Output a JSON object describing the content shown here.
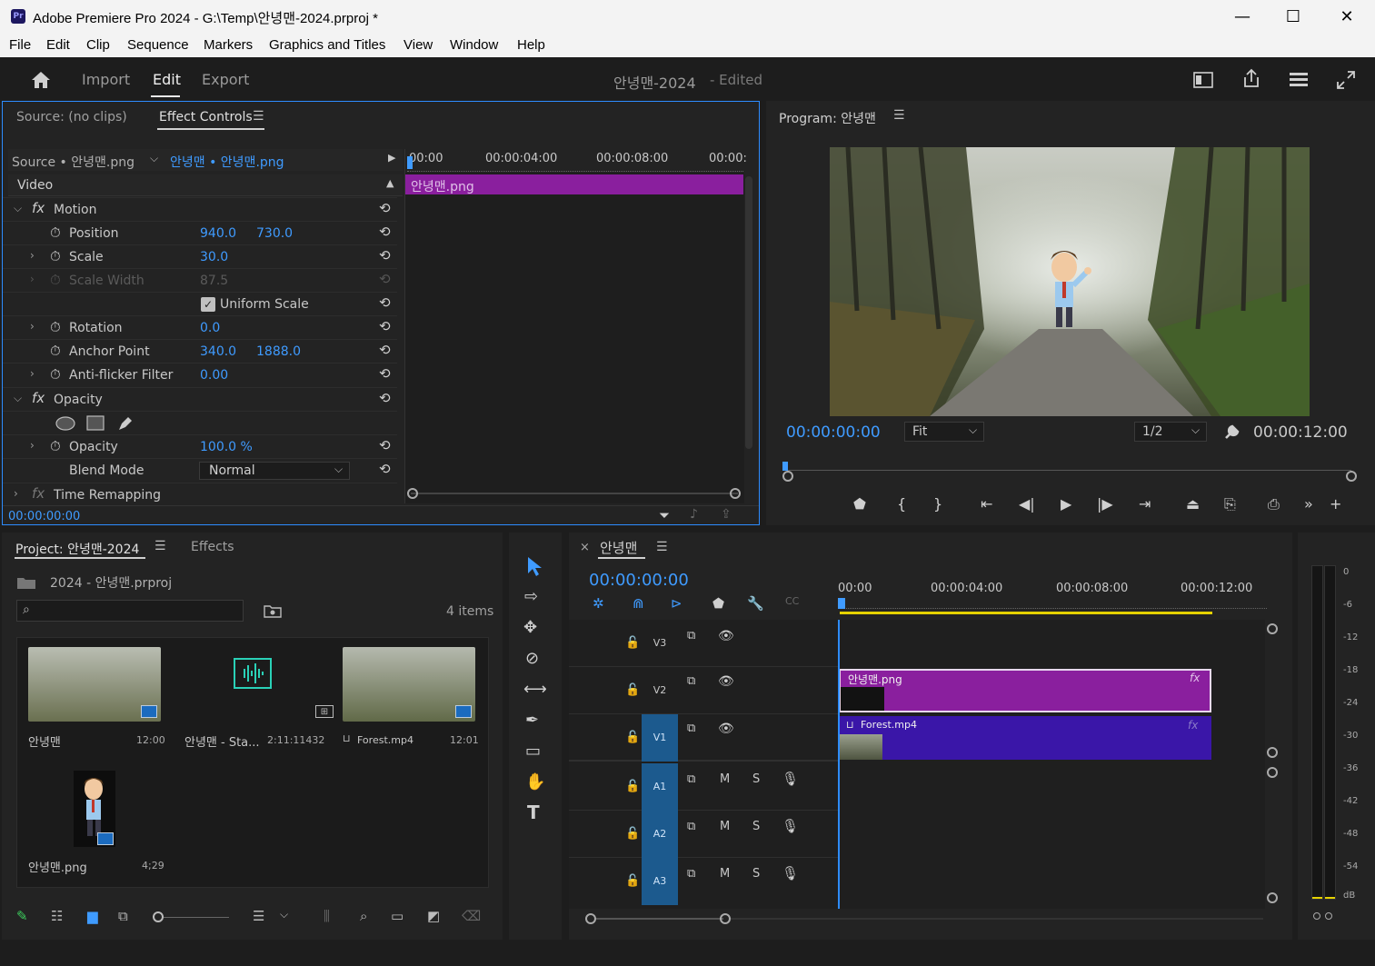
{
  "window": {
    "title": "Adobe Premiere Pro 2024 - G:\\Temp\\안녕맨-2024.prproj *",
    "app_badge": "Pr",
    "minimize": "—",
    "maximize": "☐",
    "close": "✕"
  },
  "menu": [
    "File",
    "Edit",
    "Clip",
    "Sequence",
    "Markers",
    "Graphics and Titles",
    "View",
    "Window",
    "Help"
  ],
  "header": {
    "tabs": [
      "Import",
      "Edit",
      "Export"
    ],
    "active_tab": "Edit",
    "project_name": "안녕맨-2024",
    "edited_label": "- Edited"
  },
  "effect_controls": {
    "source_tab": "Source: (no clips)",
    "effect_tab": "Effect Controls",
    "source_label": "Source • 안녕맨.png",
    "clip_selector": "안녕맨 • 안녕맨.png",
    "timecodes": [
      "00:00",
      "00:00:04:00",
      "00:00:08:00",
      "00:00:"
    ],
    "clip_bar_label": "안녕맨.png",
    "section_video": "Video",
    "motion": "Motion",
    "position_label": "Position",
    "position_x": "940.0",
    "position_y": "730.0",
    "scale_label": "Scale",
    "scale_value": "30.0",
    "scale_width_label": "Scale Width",
    "scale_width_value": "87.5",
    "uniform_scale": "Uniform Scale",
    "rotation_label": "Rotation",
    "rotation_value": "0.0",
    "anchor_label": "Anchor Point",
    "anchor_x": "340.0",
    "anchor_y": "1888.0",
    "antiflicker_label": "Anti-flicker Filter",
    "antiflicker_value": "0.00",
    "opacity_section": "Opacity",
    "opacity_label": "Opacity",
    "opacity_value": "100.0 %",
    "blend_label": "Blend Mode",
    "blend_value": "Normal",
    "time_remap": "Time Remapping",
    "current_time": "00:00:00:00"
  },
  "program": {
    "title": "Program: 안녕맨",
    "timecode": "00:00:00:00",
    "fit": "Fit",
    "resolution": "1/2",
    "duration": "00:00:12:00"
  },
  "project": {
    "tab": "Project: 안녕맨-2024",
    "effects_tab": "Effects",
    "path": "2024 - 안녕맨.prproj",
    "items_count": "4 items",
    "items": [
      {
        "name": "안녕맨",
        "meta": "12:00"
      },
      {
        "name": "안녕맨 - Sta...",
        "meta": "2:11:11432"
      },
      {
        "name": "Forest.mp4",
        "meta": "12:01"
      },
      {
        "name": "안녕맨.png",
        "meta": "4;29"
      }
    ]
  },
  "timeline": {
    "tab": "안녕맨",
    "timecode": "00:00:00:00",
    "ruler": [
      "00:00",
      "00:00:04:00",
      "00:00:08:00",
      "00:00:12:00"
    ],
    "tracks": [
      "V3",
      "V2",
      "V1",
      "A1",
      "A2",
      "A3"
    ],
    "clip_v2": "안녕맨.png",
    "clip_v1": "Forest.mp4",
    "mute": "M",
    "solo": "S"
  },
  "meter": {
    "scale": [
      "0",
      "-6",
      "-12",
      "-18",
      "-24",
      "-30",
      "-36",
      "-42",
      "-48",
      "-54",
      "dB"
    ]
  },
  "colors": {
    "accent": "#3f9bff",
    "clip_png": "#8a1f9e",
    "clip_video": "#3a16a8",
    "track_active": "#1c5a8e"
  }
}
